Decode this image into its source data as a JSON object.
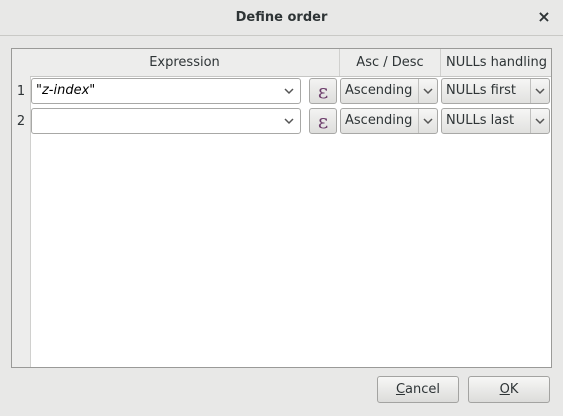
{
  "dialog": {
    "title": "Define order",
    "close_glyph": "×"
  },
  "table": {
    "columns": [
      "Expression",
      "Asc / Desc",
      "NULLs handling"
    ],
    "rows": [
      {
        "num": "1",
        "expression": "\"z-index\"",
        "expression_button": "ε",
        "order": "Ascending",
        "nulls": "NULLs first"
      },
      {
        "num": "2",
        "expression": "",
        "expression_button": "ε",
        "order": "Ascending",
        "nulls": "NULLs last"
      }
    ]
  },
  "buttons": {
    "cancel_prefix": "",
    "cancel_mnemonic": "C",
    "cancel_rest": "ancel",
    "ok_prefix": "",
    "ok_mnemonic": "O",
    "ok_rest": "K"
  },
  "icons": {
    "close": "close-icon",
    "dropdown": "chevron-down-icon",
    "expression": "epsilon-icon"
  }
}
